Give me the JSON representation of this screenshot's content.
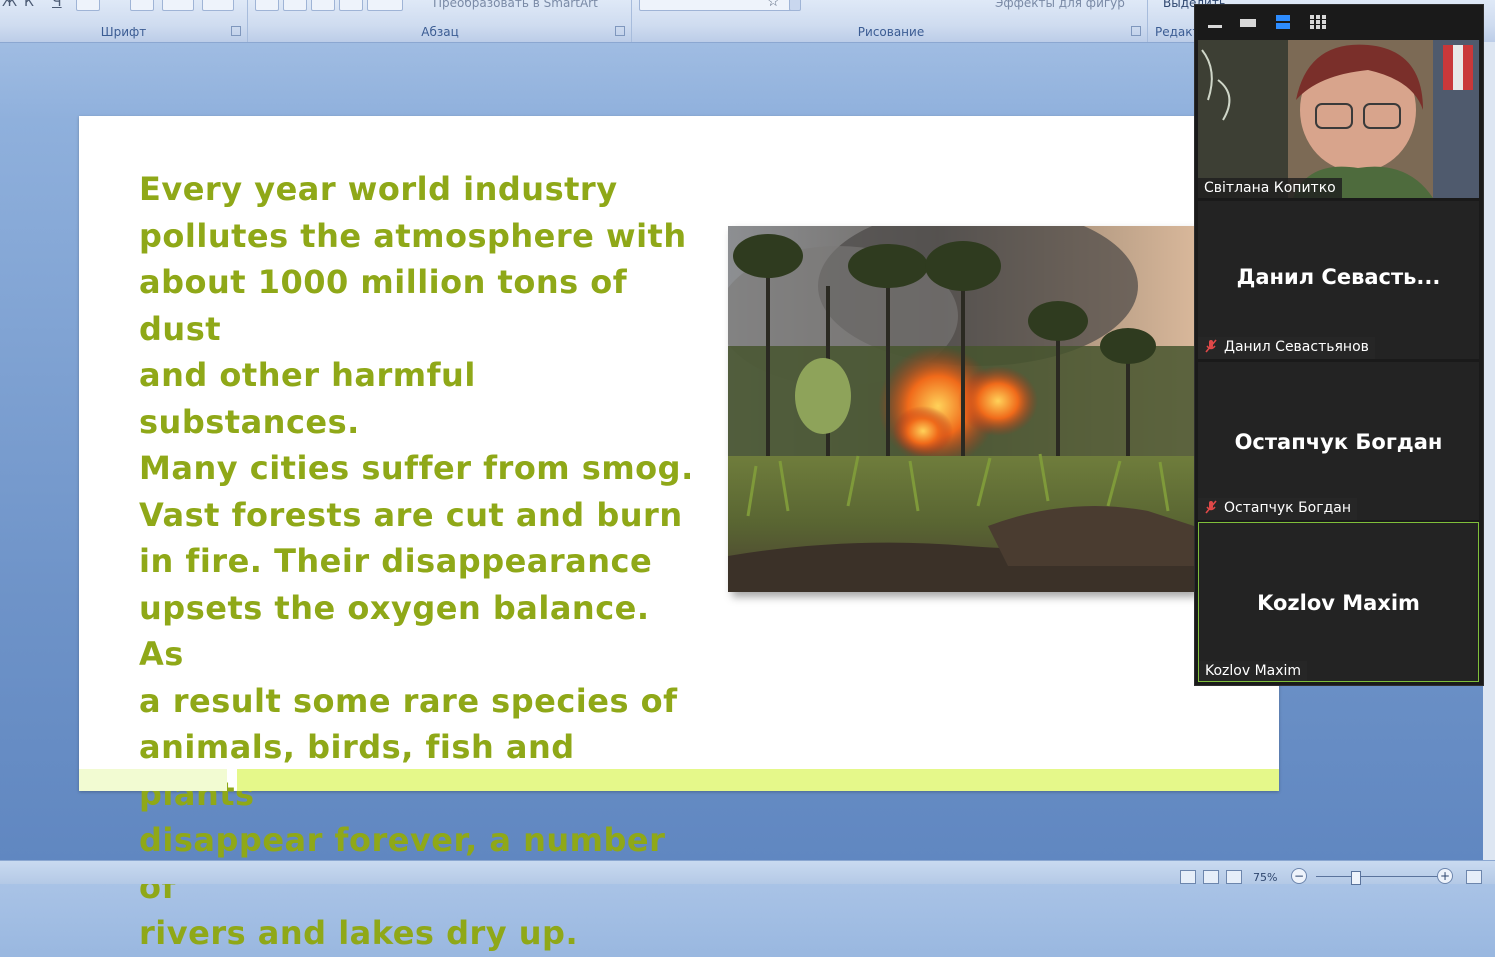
{
  "ribbon": {
    "groups": [
      {
        "label": "Шрифт"
      },
      {
        "label": "Абзац"
      },
      {
        "label": "Рисование"
      },
      {
        "label": "Редакт"
      }
    ],
    "smartart_label": "Преобразовать в SmartArt",
    "shape_effects_label": "Эффекты для фигур",
    "select_label": "Выделить"
  },
  "slide": {
    "body_text": "Every year world industry pollutes the atmosphere with about 1000 million tons of dust and other harmful substances. Many cities suffer from smog. Vast forests are cut and burn in fire. Their disappearance upsets the oxygen balance. As a result some rare species of animals, birds, fish and plants disappear forever, a number of rivers and lakes dry up.",
    "lines": [
      "Every year world industry",
      "pollutes the atmosphere with",
      "about 1000 million tons of dust",
      "and other harmful substances.",
      "Many cities suffer from smog.",
      "Vast forests are cut and burn",
      "in fire. Their disappearance",
      "upsets the oxygen balance. As",
      "a result some rare species of",
      "animals, birds, fish and plants",
      "disappear forever, a number of",
      "rivers and lakes dry up."
    ],
    "text_color": "#8fa818",
    "photo_subject": "forest-fire-photo"
  },
  "statusbar": {
    "zoom": "75%"
  },
  "zoom": {
    "participants": [
      {
        "display": "",
        "label": "Світлана Копитко",
        "muted": false,
        "video": true
      },
      {
        "display": "Данил  Севасть...",
        "label": "Данил Севастьянов",
        "muted": true,
        "video": false
      },
      {
        "display": "Остапчук Богдан",
        "label": "Остапчук Богдан",
        "muted": true,
        "video": false
      },
      {
        "display": "Kozlov Maxim",
        "label": "Kozlov Maxim",
        "muted": false,
        "video": false,
        "active": true
      }
    ],
    "active_speaker_color": "#7fbf3a"
  }
}
